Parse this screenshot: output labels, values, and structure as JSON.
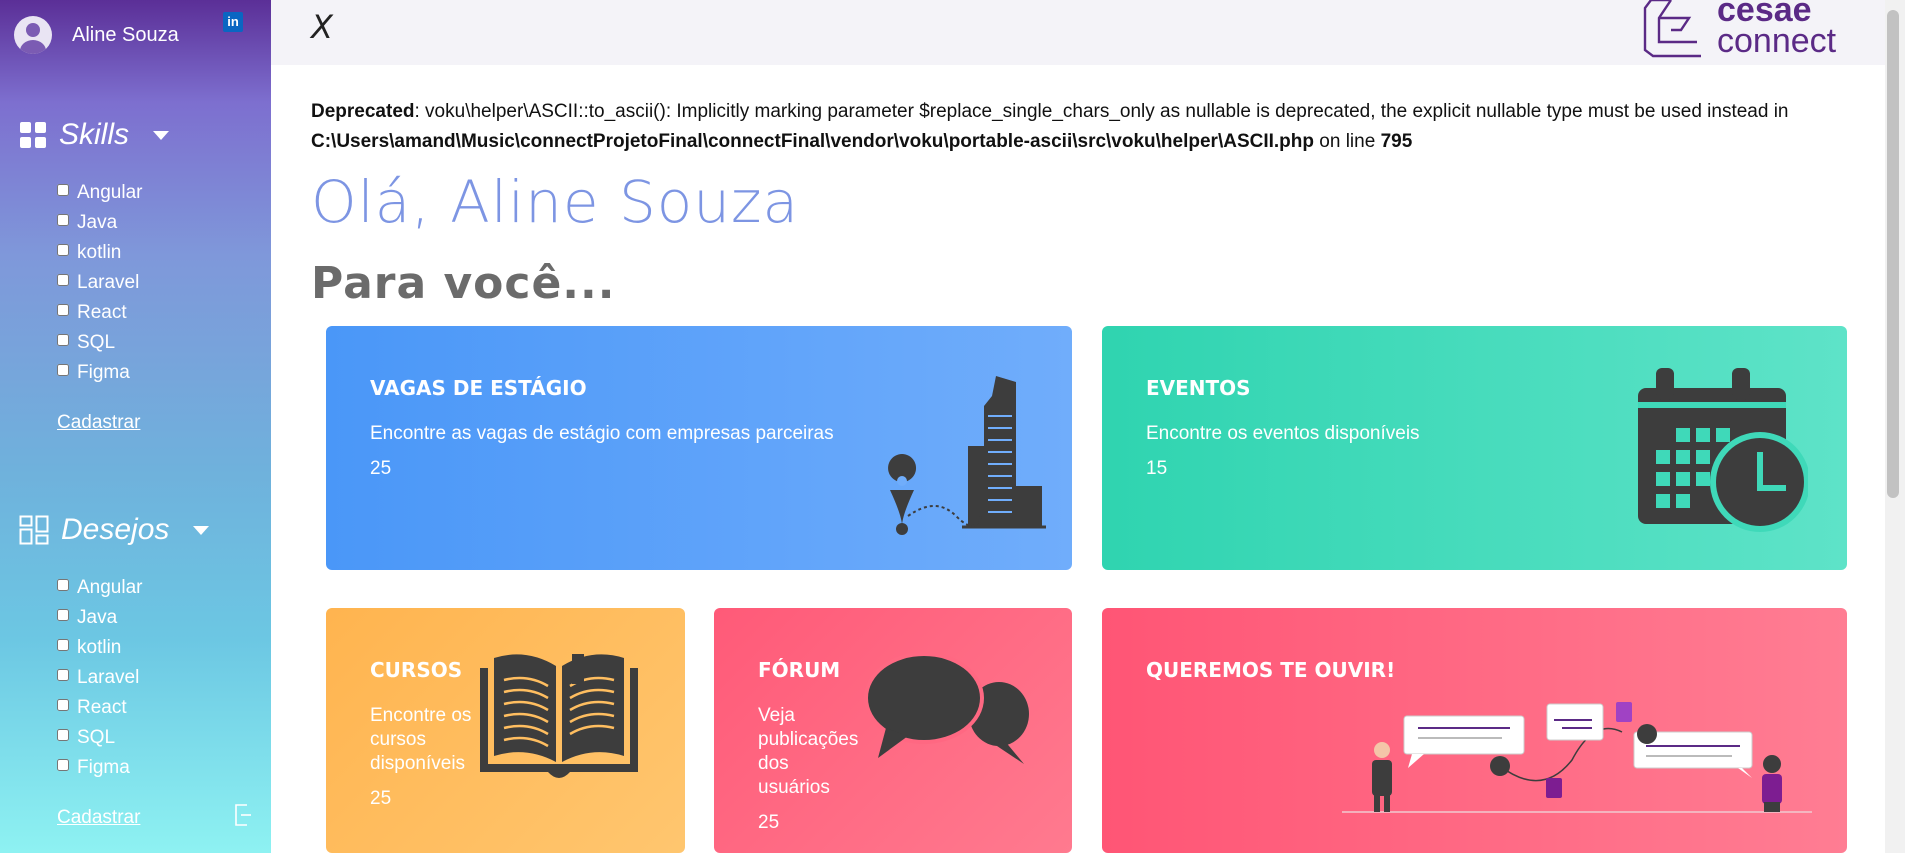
{
  "sidebar": {
    "user_name": "Aline Souza",
    "linkedin_label": "in",
    "skills": {
      "title": "Skills",
      "items": [
        "Angular",
        "Java",
        "kotlin",
        "Laravel",
        "React",
        "SQL",
        "Figma"
      ],
      "register_label": "Cadastrar"
    },
    "wishes": {
      "title": "Desejos",
      "items": [
        "Angular",
        "Java",
        "kotlin",
        "Laravel",
        "React",
        "SQL",
        "Figma"
      ],
      "register_label": "Cadastrar"
    }
  },
  "topbar": {
    "close_label": "X",
    "logo_line1": "cesae",
    "logo_line2": "connect"
  },
  "warning": {
    "label": "Deprecated",
    "message": ": voku\\helper\\ASCII::to_ascii(): Implicitly marking parameter $replace_single_chars_only as nullable is deprecated, the explicit nullable type must be used instead in ",
    "path": "C:\\Users\\amand\\Music\\connectProjetoFinal\\connectFinal\\vendor\\voku\\portable-ascii\\src\\voku\\helper\\ASCII.php",
    "on_line": " on line ",
    "line": "795"
  },
  "greeting": "Olá, Aline Souza",
  "for_you": "Para você...",
  "cards": {
    "internships": {
      "title": "VAGAS DE ESTÁGIO",
      "desc": "Encontre as vagas de estágio com empresas parceiras",
      "count": "25"
    },
    "events": {
      "title": "EVENTOS",
      "desc": "Encontre os eventos disponíveis",
      "count": "15"
    },
    "courses": {
      "title": "CURSOS",
      "desc": "Encontre os cursos disponíveis",
      "count": "25"
    },
    "forum": {
      "title": "FÓRUM",
      "desc": "Veja publicações dos usuários",
      "count": "25"
    },
    "feedback": {
      "title": "QUEREMOS TE OUVIR!"
    }
  },
  "colors": {
    "accent": "#7d95e3",
    "brand": "#5b2a86",
    "internships": "#4a97f8",
    "events": "#2fd4b0",
    "courses": "#ffb44f",
    "forum": "#ff5a78",
    "feedback": "#ff5575"
  }
}
